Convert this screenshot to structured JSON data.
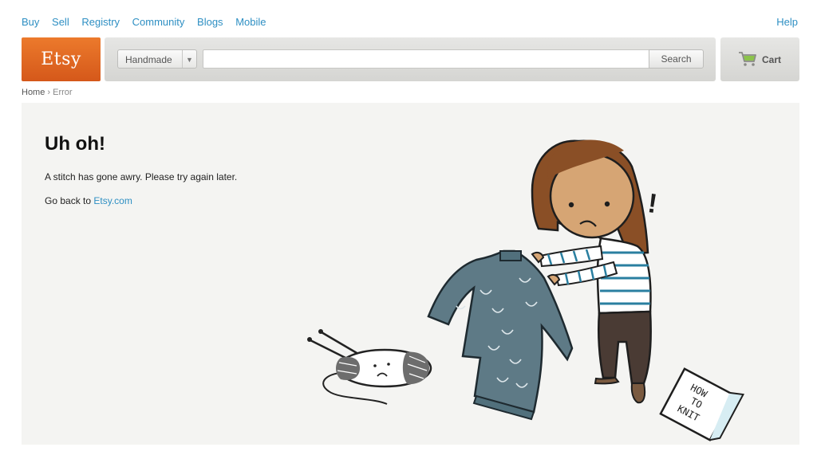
{
  "topnav": {
    "links": [
      "Buy",
      "Sell",
      "Registry",
      "Community",
      "Blogs",
      "Mobile"
    ],
    "help": "Help"
  },
  "logo": {
    "text": "Etsy",
    "color": "#e26f24"
  },
  "search": {
    "category": "Handmade",
    "value": "",
    "button": "Search"
  },
  "cart": {
    "label": "Cart"
  },
  "breadcrumb": {
    "home": "Home",
    "sep": "›",
    "current": "Error"
  },
  "error": {
    "title": "Uh oh!",
    "message": "A stitch has gone awry. Please try again later.",
    "back_prefix": "Go back to",
    "back_link": "Etsy.com"
  },
  "illustration": {
    "booklet_text": [
      "HOW",
      "TO",
      "KNIT"
    ],
    "exclamation": "!"
  },
  "colors": {
    "link": "#2e8fc3",
    "panel": "#f4f4f2",
    "sweater": "#5e7a86"
  }
}
